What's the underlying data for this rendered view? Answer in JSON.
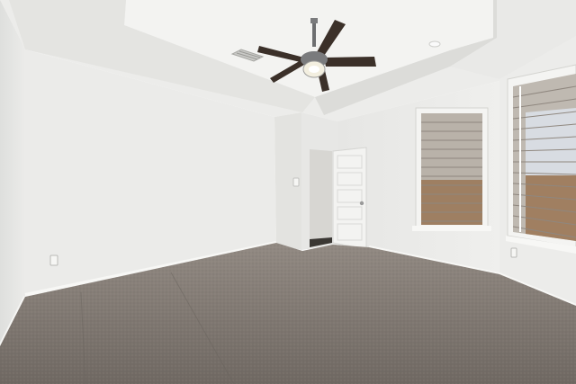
{
  "scene": {
    "subject": "empty-room",
    "colors": {
      "wall": "#e9e9e7",
      "wall_shadow": "#dcdcd9",
      "ceiling": "#ededeb",
      "tray_face": "#e2e2df",
      "carpet": "#7d7670",
      "carpet_dark": "#6f6862",
      "trim": "#f6f6f4",
      "blind": "#c9c3bb",
      "blind_slat": "#a69f96",
      "fan_blade": "#3b3029",
      "fan_metal": "#7a7b7d",
      "door": "#f2f2f0",
      "doorway_dark": "#3a3733"
    },
    "icons": [
      "ceiling-fan-icon",
      "air-vent-icon",
      "recessed-light-icon",
      "door-knob-icon",
      "outlet-icon"
    ]
  }
}
